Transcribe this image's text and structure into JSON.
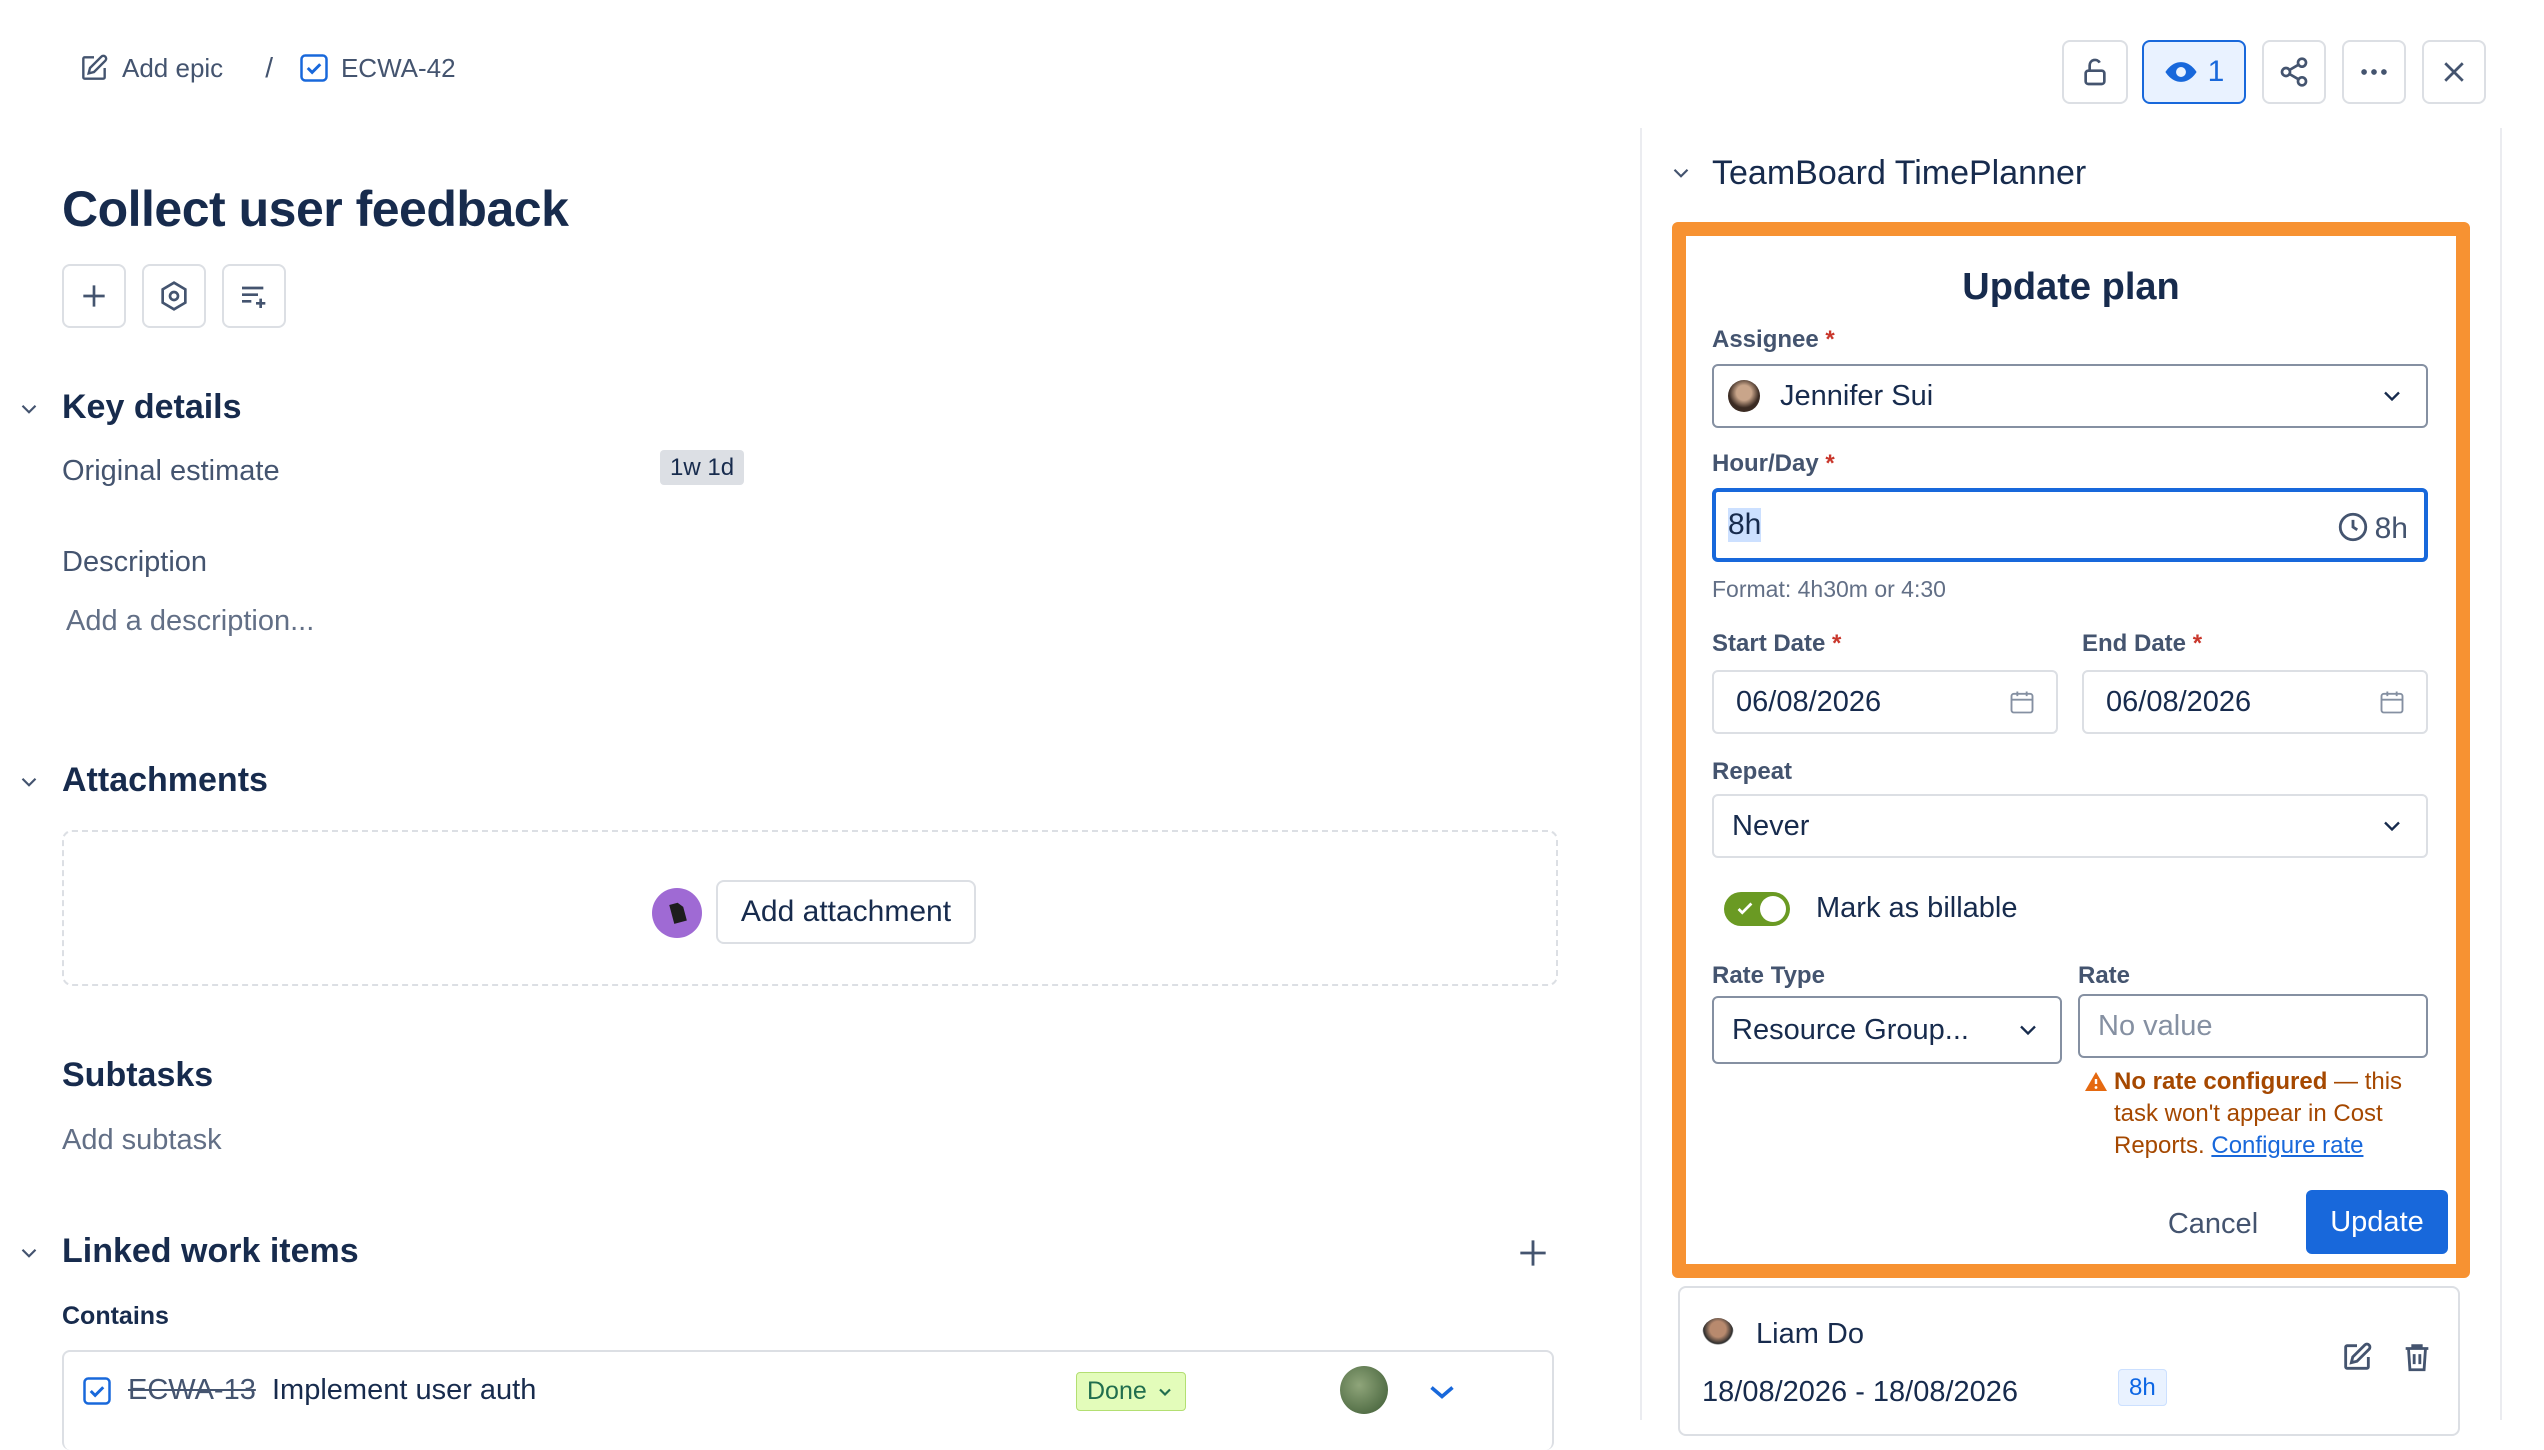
{
  "breadcrumb": {
    "add_epic": "Add epic",
    "separator": "/",
    "issue_key": "ECWA-42"
  },
  "header": {
    "watch_count": "1"
  },
  "issue": {
    "title": "Collect user feedback"
  },
  "key_details": {
    "heading": "Key details",
    "original_estimate_label": "Original estimate",
    "original_estimate_value": "1w 1d",
    "description_label": "Description",
    "description_placeholder": "Add a description..."
  },
  "attachments": {
    "heading": "Attachments",
    "add_button": "Add attachment"
  },
  "subtasks": {
    "heading": "Subtasks",
    "add_link": "Add subtask"
  },
  "linked": {
    "heading": "Linked work items",
    "contains_label": "Contains",
    "items": [
      {
        "key": "ECWA-13",
        "summary": "Implement user auth",
        "status": "Done"
      }
    ]
  },
  "panel": {
    "title": "TeamBoard TimePlanner",
    "form": {
      "title": "Update plan",
      "assignee_label": "Assignee",
      "assignee_value": "Jennifer Sui",
      "hourday_label": "Hour/Day",
      "hourday_value": "8h",
      "hourday_suffix": "8h",
      "hourday_hint": "Format: 4h30m or 4:30",
      "start_label": "Start Date",
      "start_value": "06/08/2026",
      "end_label": "End Date",
      "end_value": "06/08/2026",
      "repeat_label": "Repeat",
      "repeat_value": "Never",
      "billable_label": "Mark as billable",
      "billable_on": true,
      "rate_type_label": "Rate Type",
      "rate_type_value": "Resource Group...",
      "rate_label": "Rate",
      "rate_placeholder": "No value",
      "warning_bold": "No rate configured",
      "warning_text": " — this task won't appear in Cost Reports. ",
      "warning_link": "Configure rate",
      "cancel": "Cancel",
      "update": "Update",
      "required_mark": "*"
    },
    "plan_card": {
      "assignee": "Liam Do",
      "date_range": "18/08/2026 - 18/08/2026",
      "hours": "8h"
    }
  },
  "colors": {
    "accent_blue": "#1868db",
    "highlight_orange": "#f79232",
    "toggle_green": "#6a9a23",
    "warning_text": "#a54800"
  }
}
